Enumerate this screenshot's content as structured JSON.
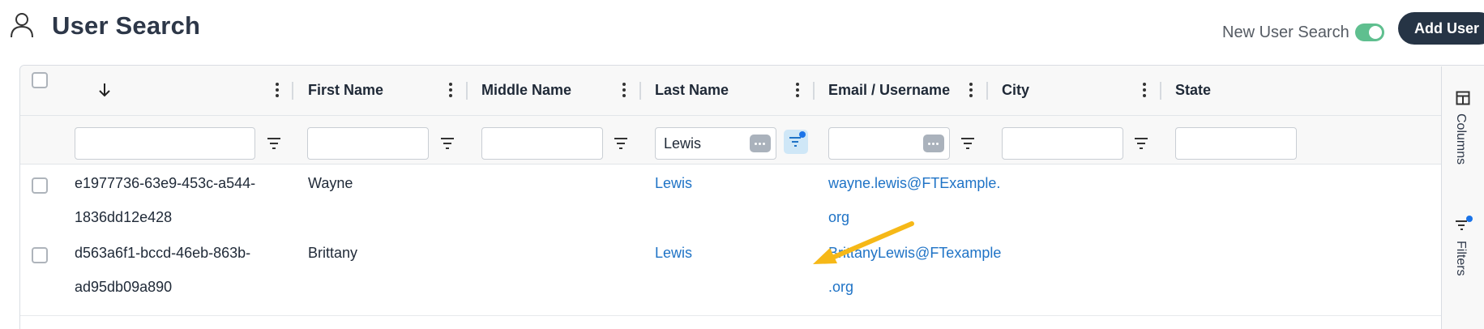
{
  "header": {
    "title": "User Search",
    "toggle_label": "New User Search",
    "toggle_on": true,
    "add_user_label": "Add User"
  },
  "grid": {
    "columns": [
      {
        "label": "",
        "sort_icon": "arrow-down-icon"
      },
      {
        "label": "First Name"
      },
      {
        "label": "Middle Name"
      },
      {
        "label": "Last Name"
      },
      {
        "label": "Email / Username"
      },
      {
        "label": "City"
      },
      {
        "label": "State"
      }
    ],
    "filters": {
      "id": "",
      "first_name": "",
      "middle_name": "",
      "last_name": "Lewis",
      "email": "",
      "city": "",
      "state": ""
    },
    "rows": [
      {
        "id_line1": "e1977736-63e9-453c-a544-",
        "id_line2": "1836dd12e428",
        "first_name": "Wayne",
        "middle_name": "",
        "last_name": "Lewis",
        "email_line1": "wayne.lewis@FTExample.",
        "email_line2": "org"
      },
      {
        "id_line1": "d563a6f1-bccd-46eb-863b-",
        "id_line2": "ad95db09a890",
        "first_name": "Brittany",
        "middle_name": "",
        "last_name": "Lewis",
        "email_line1": "BrittanyLewis@FTexample",
        "email_line2": ".org"
      }
    ]
  },
  "side_panel": {
    "columns_label": "Columns",
    "filters_label": "Filters"
  },
  "colors": {
    "accent_dark": "#263445",
    "link": "#1f73c6",
    "toggle_on": "#5fbf8f",
    "annotation_arrow": "#f6b817",
    "active_dot": "#1a73e8"
  },
  "icons": [
    "user-icon",
    "arrow-down-icon",
    "more-vert-icon",
    "filter-icon",
    "ellipsis-icon",
    "columns-icon",
    "filter-list-icon"
  ]
}
